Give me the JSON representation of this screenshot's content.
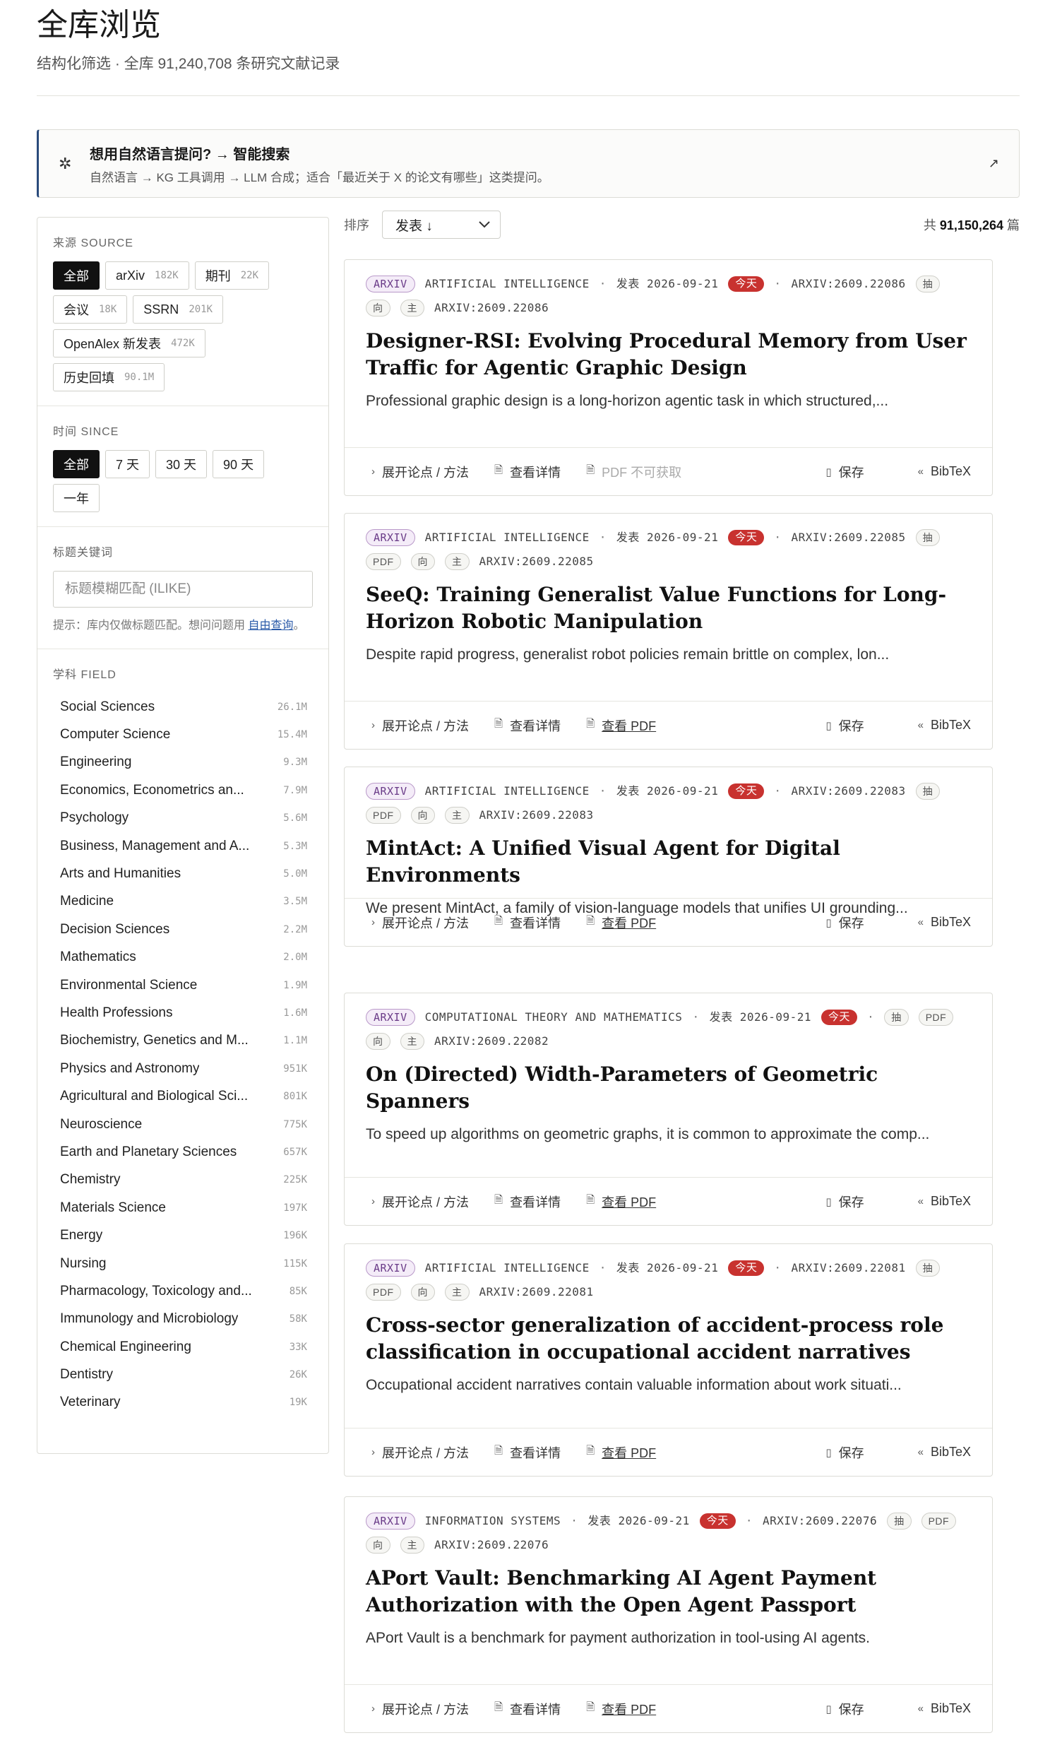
{
  "header": {
    "title": "全库浏览",
    "subtitle": "结构化筛选 · 全库 91,240,708 条研究文献记录"
  },
  "banner": {
    "title": "想用自然语言提问? → 智能搜索",
    "subtitle": "自然语言 → KG 工具调用 → LLM 合成；适合「最近关于 X 的论文有哪些」这类提问。",
    "arrow": "↗"
  },
  "filters": {
    "source": {
      "label": "来源 SOURCE",
      "options": [
        {
          "label": "全部",
          "count": "",
          "active": true
        },
        {
          "label": "arXiv",
          "count": "182K"
        },
        {
          "label": "期刊",
          "count": "22K"
        },
        {
          "label": "会议",
          "count": "18K"
        },
        {
          "label": "SSRN",
          "count": "201K"
        },
        {
          "label": "OpenAlex 新发表",
          "count": "472K"
        },
        {
          "label": "历史回填",
          "count": "90.1M"
        }
      ]
    },
    "since": {
      "label": "时间 SINCE",
      "options": [
        {
          "label": "全部",
          "active": true
        },
        {
          "label": "7 天"
        },
        {
          "label": "30 天"
        },
        {
          "label": "90 天"
        },
        {
          "label": "一年"
        }
      ]
    },
    "keyword": {
      "label": "标题关键词",
      "placeholder": "标题模糊匹配 (ILIKE)",
      "hint_prefix": "提示：库内仅做标题匹配。想问问题用 ",
      "hint_link": "自由查询",
      "hint_suffix": "。"
    },
    "field": {
      "label": "学科 FIELD",
      "items": [
        {
          "name": "Social Sciences",
          "count": "26.1M"
        },
        {
          "name": "Computer Science",
          "count": "15.4M"
        },
        {
          "name": "Engineering",
          "count": "9.3M"
        },
        {
          "name": "Economics, Econometrics an...",
          "count": "7.9M"
        },
        {
          "name": "Psychology",
          "count": "5.6M"
        },
        {
          "name": "Business, Management and A...",
          "count": "5.3M"
        },
        {
          "name": "Arts and Humanities",
          "count": "5.0M"
        },
        {
          "name": "Medicine",
          "count": "3.5M"
        },
        {
          "name": "Decision Sciences",
          "count": "2.2M"
        },
        {
          "name": "Mathematics",
          "count": "2.0M"
        },
        {
          "name": "Environmental Science",
          "count": "1.9M"
        },
        {
          "name": "Health Professions",
          "count": "1.6M"
        },
        {
          "name": "Biochemistry, Genetics and M...",
          "count": "1.1M"
        },
        {
          "name": "Physics and Astronomy",
          "count": "951K"
        },
        {
          "name": "Agricultural and Biological Sci...",
          "count": "801K"
        },
        {
          "name": "Neuroscience",
          "count": "775K"
        },
        {
          "name": "Earth and Planetary Sciences",
          "count": "657K"
        },
        {
          "name": "Chemistry",
          "count": "225K"
        },
        {
          "name": "Materials Science",
          "count": "197K"
        },
        {
          "name": "Energy",
          "count": "196K"
        },
        {
          "name": "Nursing",
          "count": "115K"
        },
        {
          "name": "Pharmacology, Toxicology and...",
          "count": "85K"
        },
        {
          "name": "Immunology and Microbiology",
          "count": "58K"
        },
        {
          "name": "Chemical Engineering",
          "count": "33K"
        },
        {
          "name": "Dentistry",
          "count": "26K"
        },
        {
          "name": "Veterinary",
          "count": "19K"
        }
      ]
    }
  },
  "sort": {
    "label": "排序",
    "value": "发表 ↓",
    "total_prefix": "共 ",
    "total_count": "91,150,264",
    "total_suffix": " 篇"
  },
  "actions": {
    "expand": "展开论点 / 方法",
    "details": "查看详情",
    "pdf": "查看 PDF",
    "pdf_unavailable": "PDF 不可获取",
    "save": "保存",
    "bibtex": "BibTeX"
  },
  "papers": [
    {
      "source": "ARXIV",
      "category": "ARTIFICIAL INTELLIGENCE",
      "date": "发表 2026-09-21",
      "today": "今天",
      "id": "ARXIV:2609.22086",
      "tags": [
        "抽",
        "向",
        "主"
      ],
      "pdf": false,
      "title": "Designer-RSI: Evolving Procedural Memory from User Traffic for Agentic Graphic Design",
      "abstract": "Professional graphic design is a long-horizon agentic task in which structured,..."
    },
    {
      "source": "ARXIV",
      "category": "ARTIFICIAL INTELLIGENCE",
      "date": "发表 2026-09-21",
      "today": "今天",
      "id": "ARXIV:2609.22085",
      "tags": [
        "抽",
        "PDF",
        "向",
        "主"
      ],
      "pdf": true,
      "title": "SeeQ: Training Generalist Value Functions for Long-Horizon Robotic Manipulation",
      "abstract": "Despite rapid progress, generalist robot policies remain brittle on complex, lon..."
    },
    {
      "source": "ARXIV",
      "category": "ARTIFICIAL INTELLIGENCE",
      "date": "发表 2026-09-21",
      "today": "今天",
      "id": "ARXIV:2609.22083",
      "tags": [
        "抽",
        "PDF",
        "向",
        "主"
      ],
      "pdf": true,
      "title": "MintAct: A Unified Visual Agent for Digital Environments",
      "abstract": "We present MintAct, a family of vision-language models that unifies UI grounding..."
    },
    {
      "source": "ARXIV",
      "category": "COMPUTATIONAL THEORY AND MATHEMATICS",
      "date": "发表 2026-09-21",
      "today": "今天",
      "id": "ARXIV:2609.22082",
      "tags": [
        "抽",
        "PDF",
        "向",
        "主"
      ],
      "pdf": true,
      "title": "On (Directed) Width-Parameters of Geometric Spanners",
      "abstract": "To speed up algorithms on geometric graphs, it is common to approximate the comp..."
    },
    {
      "source": "ARXIV",
      "category": "ARTIFICIAL INTELLIGENCE",
      "date": "发表 2026-09-21",
      "today": "今天",
      "id": "ARXIV:2609.22081",
      "tags": [
        "抽",
        "PDF",
        "向",
        "主"
      ],
      "pdf": true,
      "title": "Cross-sector generalization of accident-process role classification in occupational accident narratives",
      "abstract": "Occupational accident narratives contain valuable information about work situati..."
    },
    {
      "source": "ARXIV",
      "category": "INFORMATION SYSTEMS",
      "date": "发表 2026-09-21",
      "today": "今天",
      "id": "ARXIV:2609.22076",
      "tags": [
        "抽",
        "PDF",
        "向",
        "主"
      ],
      "pdf": true,
      "title": "APort Vault: Benchmarking AI Agent Payment Authorization with the Open Agent Passport",
      "abstract": "APort Vault is a benchmark for payment authorization in tool-using AI agents."
    }
  ]
}
